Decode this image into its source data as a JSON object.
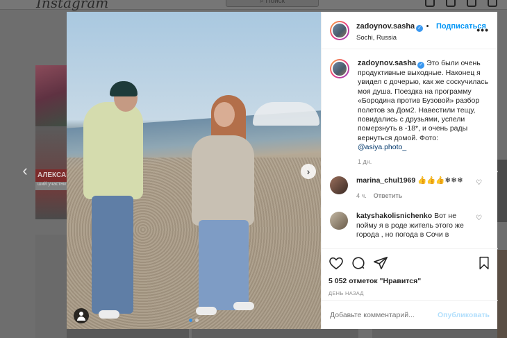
{
  "background": {
    "logo": "Instagram",
    "search_placeholder": "⌕ Поиск",
    "tv_ticker": "АЛЕКСАН",
    "tv_sub": "ший участни"
  },
  "post": {
    "username": "zadoynov.sasha",
    "follow_label": "Подписаться",
    "location": "Sochi, Russia",
    "more": "•••",
    "caption": "Это были очень продуктивные выходные. Наконец я увидел с дочерью, как же соскучилась моя душа. Поездка на программу «Бородина против Бузовой» разбор полетов за Дом2. Навестили тещу, повидались с друзьями, успели померзнуть в -18*, и очень рады вернуться домой. Фото: ",
    "caption_mention": "@asiya.photo_",
    "caption_time": "1 дн.",
    "likes": "5 052 отметок \"Нравится\"",
    "date": "ДЕНЬ НАЗАД",
    "add_comment_placeholder": "Добавьте комментарий...",
    "publish_label": "Опубликовать"
  },
  "comments": [
    {
      "username": "marina_chul1969",
      "text": "👍👍👍❄❄❄",
      "time": "4 ч.",
      "reply": "Ответить"
    },
    {
      "username": "katyshakolisnichenko",
      "text": "Вот не пойму я в роде житель этого же города , но погода в Сочи в"
    }
  ],
  "icons": {
    "prev": "‹",
    "next": "›",
    "photo_next": "›",
    "heart": "♡"
  }
}
